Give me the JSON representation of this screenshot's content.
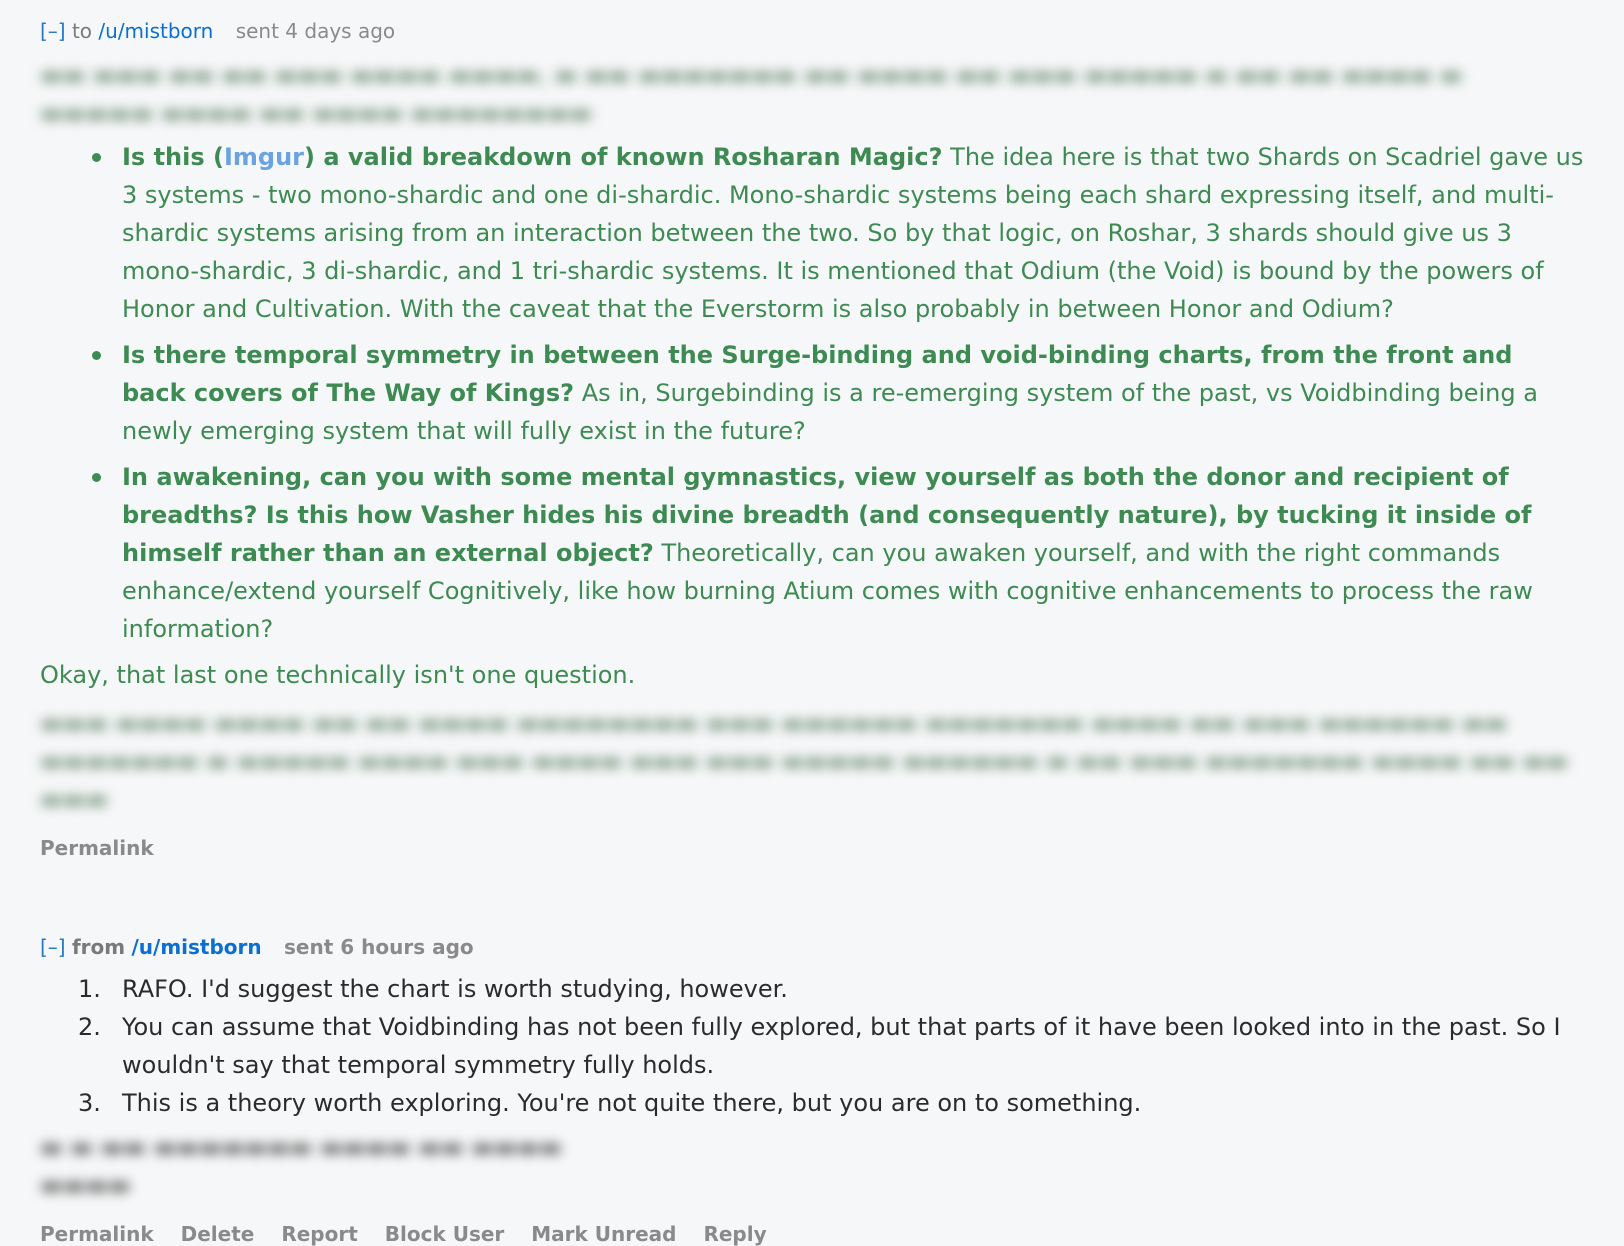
{
  "messages": [
    {
      "toggle": "[–]",
      "direction": "to",
      "user": "/u/mistborn",
      "time": "sent 4 days ago",
      "questions": [
        {
          "bold_prefix": "Is this (",
          "link": "Imgur",
          "bold_suffix": ") a valid breakdown of known Rosharan Magic?",
          "text": "The idea here is that two Shards on Scadriel gave us 3 systems - two mono-shardic and one di-shardic. Mono-shardic systems being each shard expressing itself, and multi-shardic systems arising from an interaction between the two. So by that logic, on Roshar, 3 shards should give us 3 mono-shardic, 3 di-shardic, and 1 tri-shardic systems. It is mentioned that Odium (the Void) is bound by the powers of Honor and Cultivation. With the caveat that the Everstorm is also probably in between Honor and Odium?"
        },
        {
          "bold": "Is there temporal symmetry in between the Surge-binding and void-binding charts, from the front and back covers of The Way of Kings?",
          "text": "As in, Surgebinding is a re-emerging system of the past, vs Voidbinding being a newly emerging system that will fully exist in the future?"
        },
        {
          "bold": "In awakening, can you with some mental gymnastics, view yourself as both the donor and recipient of breadths? Is this how Vasher hides his divine breadth (and consequently nature), by tucking it inside of himself rather than an external object?",
          "text": "Theoretically, can you awaken yourself, and with the right commands enhance/extend yourself Cognitively, like how burning Atium comes with cognitive enhancements to process the raw information?"
        }
      ],
      "closing": "Okay, that last one technically isn't one question.",
      "links": [
        "Permalink"
      ]
    },
    {
      "toggle": "[–]",
      "direction": "from",
      "user": "/u/mistborn",
      "time": "sent 6 hours ago",
      "answers": [
        {
          "num": "1.",
          "text": "RAFO. I'd suggest the chart is worth studying, however."
        },
        {
          "num": "2.",
          "text": "You can assume that Voidbinding has not been fully explored, but that parts of it have been looked into in the past. So I wouldn't say that temporal symmetry fully holds."
        },
        {
          "num": "3.",
          "text": "This is a theory worth exploring. You're not quite there, but you are on to something."
        }
      ],
      "links": [
        "Permalink",
        "Delete",
        "Report",
        "Block User",
        "Mark Unread",
        "Reply"
      ]
    }
  ],
  "colors": {
    "background": "#f6f7f8",
    "sent_text": "#3e8a53",
    "link_blue": "#0a6fd0",
    "imgur_link": "#6aa3e0",
    "muted": "#8a8a8a"
  }
}
